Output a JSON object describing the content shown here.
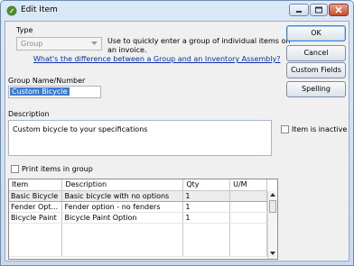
{
  "window": {
    "title": "Edit Item",
    "icon": "quickbooks-edit-icon",
    "controls": [
      "minimize-icon",
      "maximize-icon",
      "close-icon"
    ]
  },
  "form": {
    "type_label": "Type",
    "type_value": "Group",
    "type_help": "Use to quickly enter a group of individual items on an invoice.",
    "type_help_line1": "Use to quickly enter a group of individual items on",
    "type_help_line2": "an invoice.",
    "difference_link": "What's the difference between a Group and an Inventory Assembly?",
    "group_name_label": "Group Name/Number",
    "group_name_value": "Custom Bicycle",
    "description_label": "Description",
    "description_value": "Custom bicycle to your specifications",
    "inactive_label": "Item is inactive",
    "inactive_checked": false,
    "print_items_label": "Print items in group",
    "print_items_checked": false
  },
  "buttons": {
    "ok": "OK",
    "cancel": "Cancel",
    "custom_fields": "Custom Fields",
    "spelling": "Spelling"
  },
  "table": {
    "columns": [
      "Item",
      "Description",
      "Qty",
      "U/M"
    ],
    "rows": [
      {
        "item": "Basic Bicycle",
        "description": "Basic bicycle with no options",
        "qty": "1",
        "um": ""
      },
      {
        "item": "Fender Opt...",
        "description": "Fender option - no fenders",
        "qty": "1",
        "um": ""
      },
      {
        "item": "Bicycle Paint",
        "description": "Bicycle Paint Option",
        "qty": "1",
        "um": ""
      }
    ]
  },
  "colors": {
    "selection": "#3a7bd5",
    "link": "#0b2ea8",
    "close_button": "#c94a2a"
  }
}
